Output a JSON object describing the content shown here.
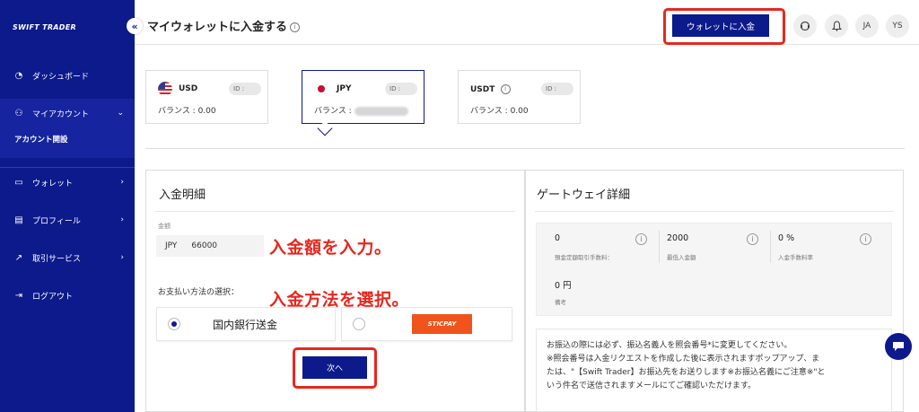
{
  "sidebar": {
    "logo": "SWIFT TRADER",
    "collapse_icon": "«",
    "items": [
      {
        "label": "ダッシュボード",
        "icon": "dashboard-icon"
      },
      {
        "label": "マイアカウント",
        "icon": "account-icon",
        "sub": "アカウント開設"
      },
      {
        "label": "ウォレット",
        "icon": "wallet-icon"
      },
      {
        "label": "プロフィール",
        "icon": "profile-icon"
      },
      {
        "label": "取引サービス",
        "icon": "chart-icon"
      },
      {
        "label": "ログアウト",
        "icon": "logout-icon"
      }
    ]
  },
  "header": {
    "title": "マイウォレットに入金する",
    "deposit_button": "ウォレットに入金",
    "lang": "JA",
    "user": "YS"
  },
  "wallets": [
    {
      "currency": "USD",
      "id_label": "ID :",
      "balance_label": "バランス : 0.00"
    },
    {
      "currency": "JPY",
      "id_label": "ID :",
      "balance_label": "バランス :"
    },
    {
      "currency": "USDT",
      "id_label": "ID :",
      "balance_label": "バランス : 0.00"
    }
  ],
  "deposit": {
    "title": "入金明細",
    "amount_label": "金額",
    "amount_currency": "JPY",
    "amount_value": "66000",
    "payment_label": "お支払い方法の選択：",
    "options": [
      {
        "label": "国内銀行送金",
        "selected": true
      },
      {
        "label": "STICPAY",
        "selected": false
      }
    ],
    "next_button": "次へ"
  },
  "annotations": {
    "enter_amount": "入金額を入力。",
    "select_method": "入金方法を選択。"
  },
  "gateway": {
    "title": "ゲートウェイ詳細",
    "fees": [
      {
        "value": "0",
        "label": "預金定額取引手数料："
      },
      {
        "value": "2000",
        "label": "最低入金額"
      },
      {
        "value": "0 %",
        "label": "入金手数料率"
      }
    ],
    "remark_value": "0 円",
    "remark_label": "備考",
    "notice_lines": [
      "お振込の際には必ず、振込名義人を照会番号*に変更してください。",
      "※照会番号は入金リクエストを作成した後に表示されますポップアップ、ま",
      "たは、\"【Swift Trader】お振込先をお送りします※お振込名義にご注意※\"と",
      "いう件名で送信されますメールにてご確認いただけます。"
    ]
  },
  "colors": {
    "brand": "#0d1a8c",
    "highlight": "#e6281f",
    "sticpay": "#f0531c"
  }
}
